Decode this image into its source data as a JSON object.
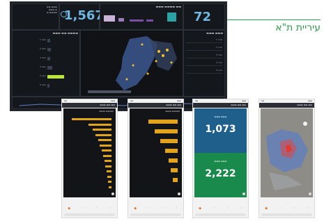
{
  "caption": "עיריית ת\"א",
  "dashboard": {
    "total_value": "1,567",
    "side_value": "72",
    "panel_titles": {
      "top_left": "מספר קריאות",
      "chart_panel": "מספר קריאות לפי נושא",
      "right_panel": "מספר פניות",
      "left_list": "קריאות לפי סטטוס"
    },
    "left_list_items": [
      {
        "label": "נושא 1",
        "value": 0.08
      },
      {
        "label": "נושא 2",
        "value": 0.12
      },
      {
        "label": "נושא 3",
        "value": 0.1
      },
      {
        "label": "נושא 4",
        "value": 0.15
      },
      {
        "label": "נושא 5",
        "value": 0.55
      },
      {
        "label": "נושא 6",
        "value": 0.06
      }
    ],
    "right_list_items": [
      "פנייה 1",
      "פנייה 2",
      "פנייה 3",
      "פנייה 4",
      "פנייה 5"
    ]
  },
  "phones": {
    "p1": {
      "title": "קריאות לפי שכונה",
      "bars": [
        0.95,
        0.55,
        0.45,
        0.38,
        0.32,
        0.28,
        0.24,
        0.2,
        0.17,
        0.15,
        0.12,
        0.1,
        0.08,
        0.06
      ]
    },
    "p2": {
      "title": "קריאות לפי נושא",
      "bars": [
        0.7,
        0.55,
        0.42,
        0.3,
        0.22,
        0.16,
        0.12
      ]
    },
    "p3": {
      "kpi_top": "1,073",
      "kpi_bottom": "2,222",
      "label_top": "קריאות פתוחות",
      "label_bottom": "קריאות סגורות",
      "title": "מדדים"
    },
    "p4": {
      "title": "מפת קריאות"
    }
  },
  "colors": {
    "accent_green": "#2e9a4a",
    "bar_yellow": "#e2a41c",
    "kpi_blue": "#1f5f8b",
    "kpi_green": "#1a8a4c",
    "map_blue": "#5e7fbf"
  }
}
